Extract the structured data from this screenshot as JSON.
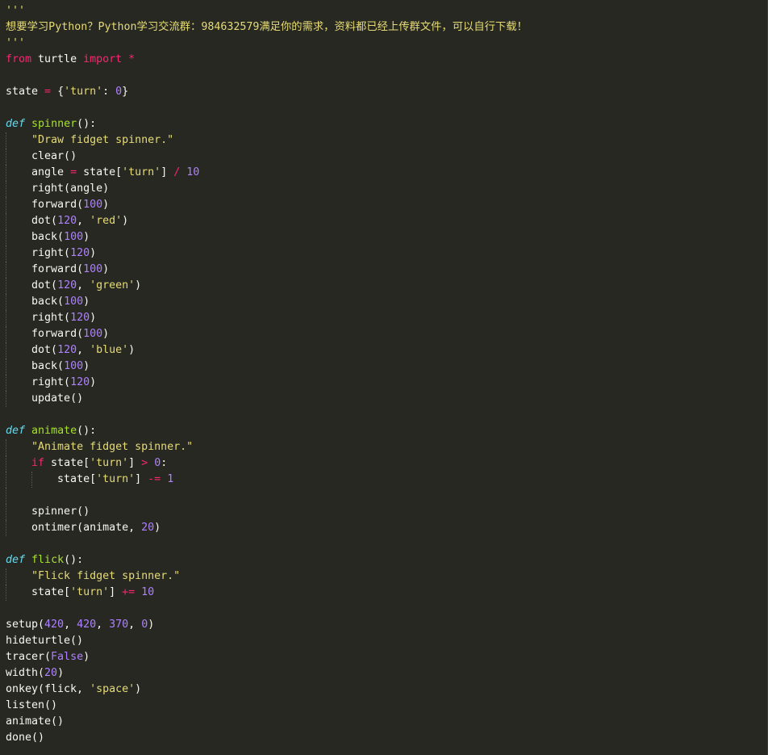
{
  "editor": {
    "lines": [
      {
        "indent": 0,
        "tokens": [
          {
            "t": "str",
            "v": "'''"
          }
        ]
      },
      {
        "indent": 0,
        "tokens": [
          {
            "t": "str",
            "v": "想要学习Python？Python学习交流群：984632579满足你的需求，资料都已经上传群文件，可以自行下载！"
          }
        ]
      },
      {
        "indent": 0,
        "tokens": [
          {
            "t": "str",
            "v": "'''"
          }
        ]
      },
      {
        "indent": 0,
        "tokens": [
          {
            "t": "kw",
            "v": "from"
          },
          {
            "t": "plain",
            "v": " turtle "
          },
          {
            "t": "kw",
            "v": "import"
          },
          {
            "t": "plain",
            "v": " "
          },
          {
            "t": "op",
            "v": "*"
          }
        ]
      },
      {
        "indent": 0,
        "tokens": []
      },
      {
        "indent": 0,
        "tokens": [
          {
            "t": "plain",
            "v": "state "
          },
          {
            "t": "op",
            "v": "="
          },
          {
            "t": "plain",
            "v": " {"
          },
          {
            "t": "str",
            "v": "'turn'"
          },
          {
            "t": "plain",
            "v": ": "
          },
          {
            "t": "num",
            "v": "0"
          },
          {
            "t": "plain",
            "v": "}"
          }
        ]
      },
      {
        "indent": 0,
        "tokens": []
      },
      {
        "indent": 0,
        "tokens": [
          {
            "t": "def",
            "v": "def"
          },
          {
            "t": "plain",
            "v": " "
          },
          {
            "t": "fn",
            "v": "spinner"
          },
          {
            "t": "plain",
            "v": "():"
          }
        ]
      },
      {
        "indent": 1,
        "tokens": [
          {
            "t": "str",
            "v": "\"Draw fidget spinner.\""
          }
        ]
      },
      {
        "indent": 1,
        "tokens": [
          {
            "t": "plain",
            "v": "clear()"
          }
        ]
      },
      {
        "indent": 1,
        "tokens": [
          {
            "t": "plain",
            "v": "angle "
          },
          {
            "t": "op",
            "v": "="
          },
          {
            "t": "plain",
            "v": " state["
          },
          {
            "t": "str",
            "v": "'turn'"
          },
          {
            "t": "plain",
            "v": "] "
          },
          {
            "t": "op",
            "v": "/"
          },
          {
            "t": "plain",
            "v": " "
          },
          {
            "t": "num",
            "v": "10"
          }
        ]
      },
      {
        "indent": 1,
        "tokens": [
          {
            "t": "plain",
            "v": "right(angle)"
          }
        ]
      },
      {
        "indent": 1,
        "tokens": [
          {
            "t": "plain",
            "v": "forward("
          },
          {
            "t": "num",
            "v": "100"
          },
          {
            "t": "plain",
            "v": ")"
          }
        ]
      },
      {
        "indent": 1,
        "tokens": [
          {
            "t": "plain",
            "v": "dot("
          },
          {
            "t": "num",
            "v": "120"
          },
          {
            "t": "plain",
            "v": ", "
          },
          {
            "t": "str",
            "v": "'red'"
          },
          {
            "t": "plain",
            "v": ")"
          }
        ]
      },
      {
        "indent": 1,
        "tokens": [
          {
            "t": "plain",
            "v": "back("
          },
          {
            "t": "num",
            "v": "100"
          },
          {
            "t": "plain",
            "v": ")"
          }
        ]
      },
      {
        "indent": 1,
        "tokens": [
          {
            "t": "plain",
            "v": "right("
          },
          {
            "t": "num",
            "v": "120"
          },
          {
            "t": "plain",
            "v": ")"
          }
        ]
      },
      {
        "indent": 1,
        "tokens": [
          {
            "t": "plain",
            "v": "forward("
          },
          {
            "t": "num",
            "v": "100"
          },
          {
            "t": "plain",
            "v": ")"
          }
        ]
      },
      {
        "indent": 1,
        "tokens": [
          {
            "t": "plain",
            "v": "dot("
          },
          {
            "t": "num",
            "v": "120"
          },
          {
            "t": "plain",
            "v": ", "
          },
          {
            "t": "str",
            "v": "'green'"
          },
          {
            "t": "plain",
            "v": ")"
          }
        ]
      },
      {
        "indent": 1,
        "tokens": [
          {
            "t": "plain",
            "v": "back("
          },
          {
            "t": "num",
            "v": "100"
          },
          {
            "t": "plain",
            "v": ")"
          }
        ]
      },
      {
        "indent": 1,
        "tokens": [
          {
            "t": "plain",
            "v": "right("
          },
          {
            "t": "num",
            "v": "120"
          },
          {
            "t": "plain",
            "v": ")"
          }
        ]
      },
      {
        "indent": 1,
        "tokens": [
          {
            "t": "plain",
            "v": "forward("
          },
          {
            "t": "num",
            "v": "100"
          },
          {
            "t": "plain",
            "v": ")"
          }
        ]
      },
      {
        "indent": 1,
        "tokens": [
          {
            "t": "plain",
            "v": "dot("
          },
          {
            "t": "num",
            "v": "120"
          },
          {
            "t": "plain",
            "v": ", "
          },
          {
            "t": "str",
            "v": "'blue'"
          },
          {
            "t": "plain",
            "v": ")"
          }
        ]
      },
      {
        "indent": 1,
        "tokens": [
          {
            "t": "plain",
            "v": "back("
          },
          {
            "t": "num",
            "v": "100"
          },
          {
            "t": "plain",
            "v": ")"
          }
        ]
      },
      {
        "indent": 1,
        "tokens": [
          {
            "t": "plain",
            "v": "right("
          },
          {
            "t": "num",
            "v": "120"
          },
          {
            "t": "plain",
            "v": ")"
          }
        ]
      },
      {
        "indent": 1,
        "tokens": [
          {
            "t": "plain",
            "v": "update()"
          }
        ]
      },
      {
        "indent": 0,
        "tokens": []
      },
      {
        "indent": 0,
        "tokens": [
          {
            "t": "def",
            "v": "def"
          },
          {
            "t": "plain",
            "v": " "
          },
          {
            "t": "fn",
            "v": "animate"
          },
          {
            "t": "plain",
            "v": "():"
          }
        ]
      },
      {
        "indent": 1,
        "tokens": [
          {
            "t": "str",
            "v": "\"Animate fidget spinner.\""
          }
        ]
      },
      {
        "indent": 1,
        "tokens": [
          {
            "t": "kw",
            "v": "if"
          },
          {
            "t": "plain",
            "v": " state["
          },
          {
            "t": "str",
            "v": "'turn'"
          },
          {
            "t": "plain",
            "v": "] "
          },
          {
            "t": "op",
            "v": ">"
          },
          {
            "t": "plain",
            "v": " "
          },
          {
            "t": "num",
            "v": "0"
          },
          {
            "t": "plain",
            "v": ":"
          }
        ]
      },
      {
        "indent": 2,
        "tokens": [
          {
            "t": "plain",
            "v": "state["
          },
          {
            "t": "str",
            "v": "'turn'"
          },
          {
            "t": "plain",
            "v": "] "
          },
          {
            "t": "op",
            "v": "-="
          },
          {
            "t": "plain",
            "v": " "
          },
          {
            "t": "num",
            "v": "1"
          }
        ]
      },
      {
        "indent": 1,
        "tokens": []
      },
      {
        "indent": 1,
        "tokens": [
          {
            "t": "plain",
            "v": "spinner()"
          }
        ]
      },
      {
        "indent": 1,
        "tokens": [
          {
            "t": "plain",
            "v": "ontimer(animate, "
          },
          {
            "t": "num",
            "v": "20"
          },
          {
            "t": "plain",
            "v": ")"
          }
        ]
      },
      {
        "indent": 0,
        "tokens": []
      },
      {
        "indent": 0,
        "tokens": [
          {
            "t": "def",
            "v": "def"
          },
          {
            "t": "plain",
            "v": " "
          },
          {
            "t": "fn",
            "v": "flick"
          },
          {
            "t": "plain",
            "v": "():"
          }
        ]
      },
      {
        "indent": 1,
        "tokens": [
          {
            "t": "str",
            "v": "\"Flick fidget spinner.\""
          }
        ]
      },
      {
        "indent": 1,
        "tokens": [
          {
            "t": "plain",
            "v": "state["
          },
          {
            "t": "str",
            "v": "'turn'"
          },
          {
            "t": "plain",
            "v": "] "
          },
          {
            "t": "op",
            "v": "+="
          },
          {
            "t": "plain",
            "v": " "
          },
          {
            "t": "num",
            "v": "10"
          }
        ]
      },
      {
        "indent": 0,
        "tokens": []
      },
      {
        "indent": 0,
        "tokens": [
          {
            "t": "plain",
            "v": "setup("
          },
          {
            "t": "num",
            "v": "420"
          },
          {
            "t": "plain",
            "v": ", "
          },
          {
            "t": "num",
            "v": "420"
          },
          {
            "t": "plain",
            "v": ", "
          },
          {
            "t": "num",
            "v": "370"
          },
          {
            "t": "plain",
            "v": ", "
          },
          {
            "t": "num",
            "v": "0"
          },
          {
            "t": "plain",
            "v": ")"
          }
        ]
      },
      {
        "indent": 0,
        "tokens": [
          {
            "t": "plain",
            "v": "hideturtle()"
          }
        ]
      },
      {
        "indent": 0,
        "tokens": [
          {
            "t": "plain",
            "v": "tracer("
          },
          {
            "t": "num",
            "v": "False"
          },
          {
            "t": "plain",
            "v": ")"
          }
        ]
      },
      {
        "indent": 0,
        "tokens": [
          {
            "t": "plain",
            "v": "width("
          },
          {
            "t": "num",
            "v": "20"
          },
          {
            "t": "plain",
            "v": ")"
          }
        ]
      },
      {
        "indent": 0,
        "tokens": [
          {
            "t": "plain",
            "v": "onkey(flick, "
          },
          {
            "t": "str",
            "v": "'space'"
          },
          {
            "t": "plain",
            "v": ")"
          }
        ]
      },
      {
        "indent": 0,
        "tokens": [
          {
            "t": "plain",
            "v": "listen()"
          }
        ]
      },
      {
        "indent": 0,
        "tokens": [
          {
            "t": "plain",
            "v": "animate()"
          }
        ]
      },
      {
        "indent": 0,
        "tokens": [
          {
            "t": "plain",
            "v": "done()"
          }
        ]
      }
    ]
  },
  "colors": {
    "background": "#272822",
    "keyword": "#f92672",
    "def": "#66d9ef",
    "function": "#a6e22e",
    "string": "#e6db74",
    "number": "#ae81ff",
    "text": "#f8f8f2"
  }
}
